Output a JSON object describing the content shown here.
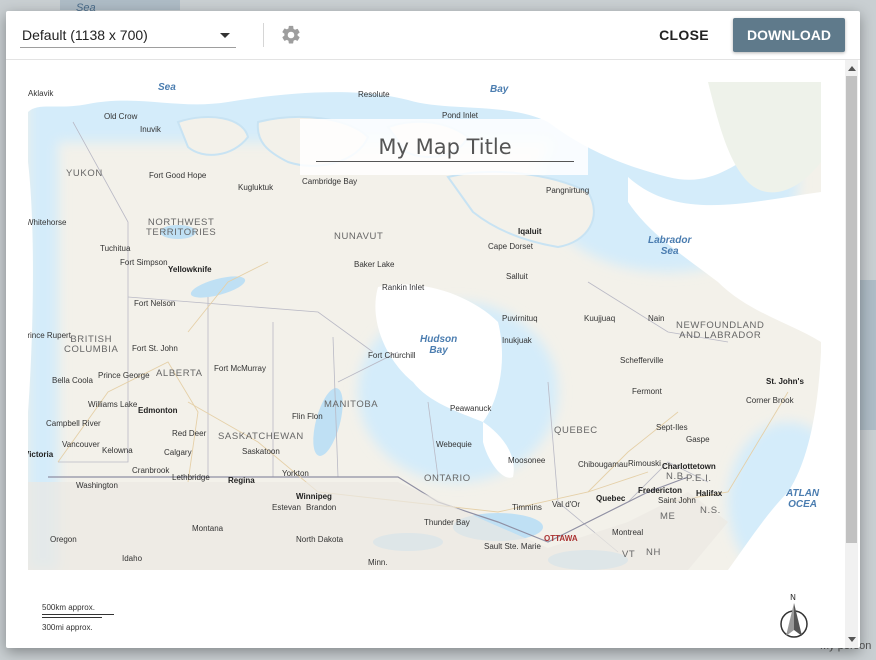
{
  "dialog": {
    "size_select": {
      "selected": "Default (1138 x 700)"
    },
    "settings_icon": "gear-icon",
    "close_label": "CLOSE",
    "download_label": "DOWNLOAD",
    "accent_color": "#5f7a8b"
  },
  "map": {
    "title": "My Map Title",
    "water_labels": [
      "Sea",
      "Bay",
      "Labrador\nSea",
      "Hudson\nBay",
      "ATLAN\nOCEA"
    ],
    "region_labels": [
      "YUKON",
      "NORTHWEST\nTERRITORIES",
      "NUNAVUT",
      "BRITISH\nCOLUMBIA",
      "ALBERTA",
      "SASKATCHEWAN",
      "MANITOBA",
      "ONTARIO",
      "QUEBEC",
      "NEWFOUNDLAND\nAND LABRADOR",
      "N.B.",
      "P.E.I.",
      "N.S.",
      "ME",
      "VT",
      "NH"
    ],
    "places": [
      "Aklavik",
      "Resolute",
      "Pond Inlet",
      "Old Crow",
      "Inuvik",
      "Fort Good Hope",
      "Kugluktuk",
      "Cambridge Bay",
      "Pangnirtung",
      "Whitehorse",
      "Iqaluit",
      "Cape Dorset",
      "Tuchitua",
      "Fort Simpson",
      "Yellowknife",
      "Baker Lake",
      "Salluit",
      "Rankin Inlet",
      "Fort Nelson",
      "Puvirnituq",
      "Kuujjuaq",
      "Nain",
      "Prince Rupert",
      "Fort St. John",
      "Inukjuak",
      "Fort Churchill",
      "Schefferville",
      "Prince George",
      "Fort McMurray",
      "Bella Coola",
      "St. John's",
      "Fermont",
      "Williams Lake",
      "Edmonton",
      "Peawanuck",
      "Corner Brook",
      "Campbell River",
      "Flin Flon",
      "Sept-Iles",
      "Red Deer",
      "Vancouver",
      "Gaspe",
      "Webequie",
      "Kelowna",
      "Calgary",
      "Saskatoon",
      "Victoria",
      "Moosonee",
      "Chibougamau",
      "Rimouski",
      "Charlottetown",
      "Cranbrook",
      "Lethbridge",
      "Regina",
      "Yorkton",
      "Washington",
      "Winnipeg",
      "Fredericton",
      "Halifax",
      "Saint John",
      "Estevan",
      "Brandon",
      "Quebec",
      "Timmins",
      "Val d'Or",
      "Montana",
      "Thunder Bay",
      "Montreal",
      "Oregon",
      "North Dakota",
      "OTTAWA",
      "Idaho",
      "Sault Ste. Marie",
      "Minn."
    ],
    "scale": {
      "km": "500km approx.",
      "mi": "300mi approx."
    },
    "north_label": "N"
  },
  "background": {
    "labels": [
      "Sea",
      "Bay",
      "Labrador",
      "Sea",
      "My person"
    ]
  }
}
